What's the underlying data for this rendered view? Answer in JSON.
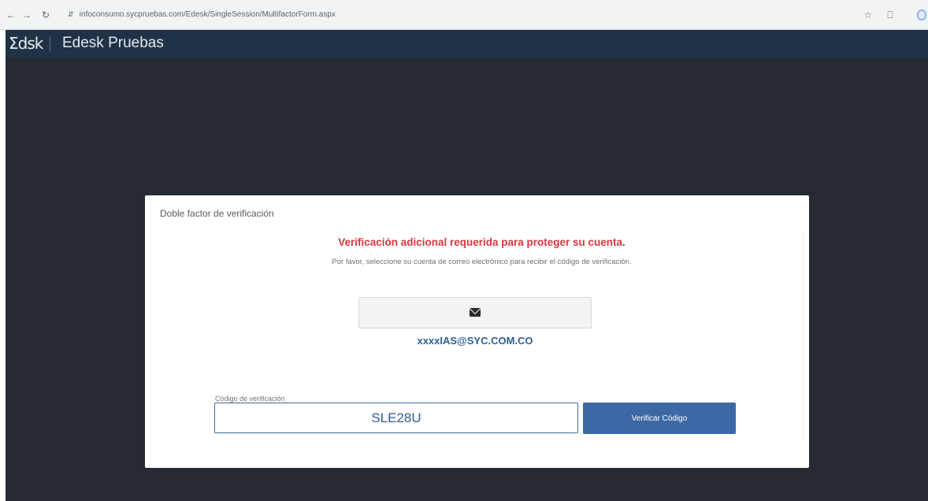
{
  "browser": {
    "url": "infoconsumo.sycpruebas.com/Edesk/SingleSession/MultifactorForm.aspx"
  },
  "header": {
    "logo_text": "Σdsk",
    "app_title": "Edesk Pruebas"
  },
  "card": {
    "title": "Doble factor de verificación",
    "headline": "Verificación adicional requerida para proteger su cuenta.",
    "subtext": "Por favor, seleccione su cuenta de correo electrónico para recibir el código de verificación.",
    "email_option_icon": "envelope-icon",
    "email": "xxxxIAS@SYC.COM.CO",
    "code_label": "Código de verificación",
    "code_value": "SLE28U",
    "verify_button": "Verificar Código"
  },
  "colors": {
    "header_bg": "#203246",
    "body_bg": "#262b33",
    "headline": "#d9363e",
    "accent_blue": "#3d68a6"
  }
}
